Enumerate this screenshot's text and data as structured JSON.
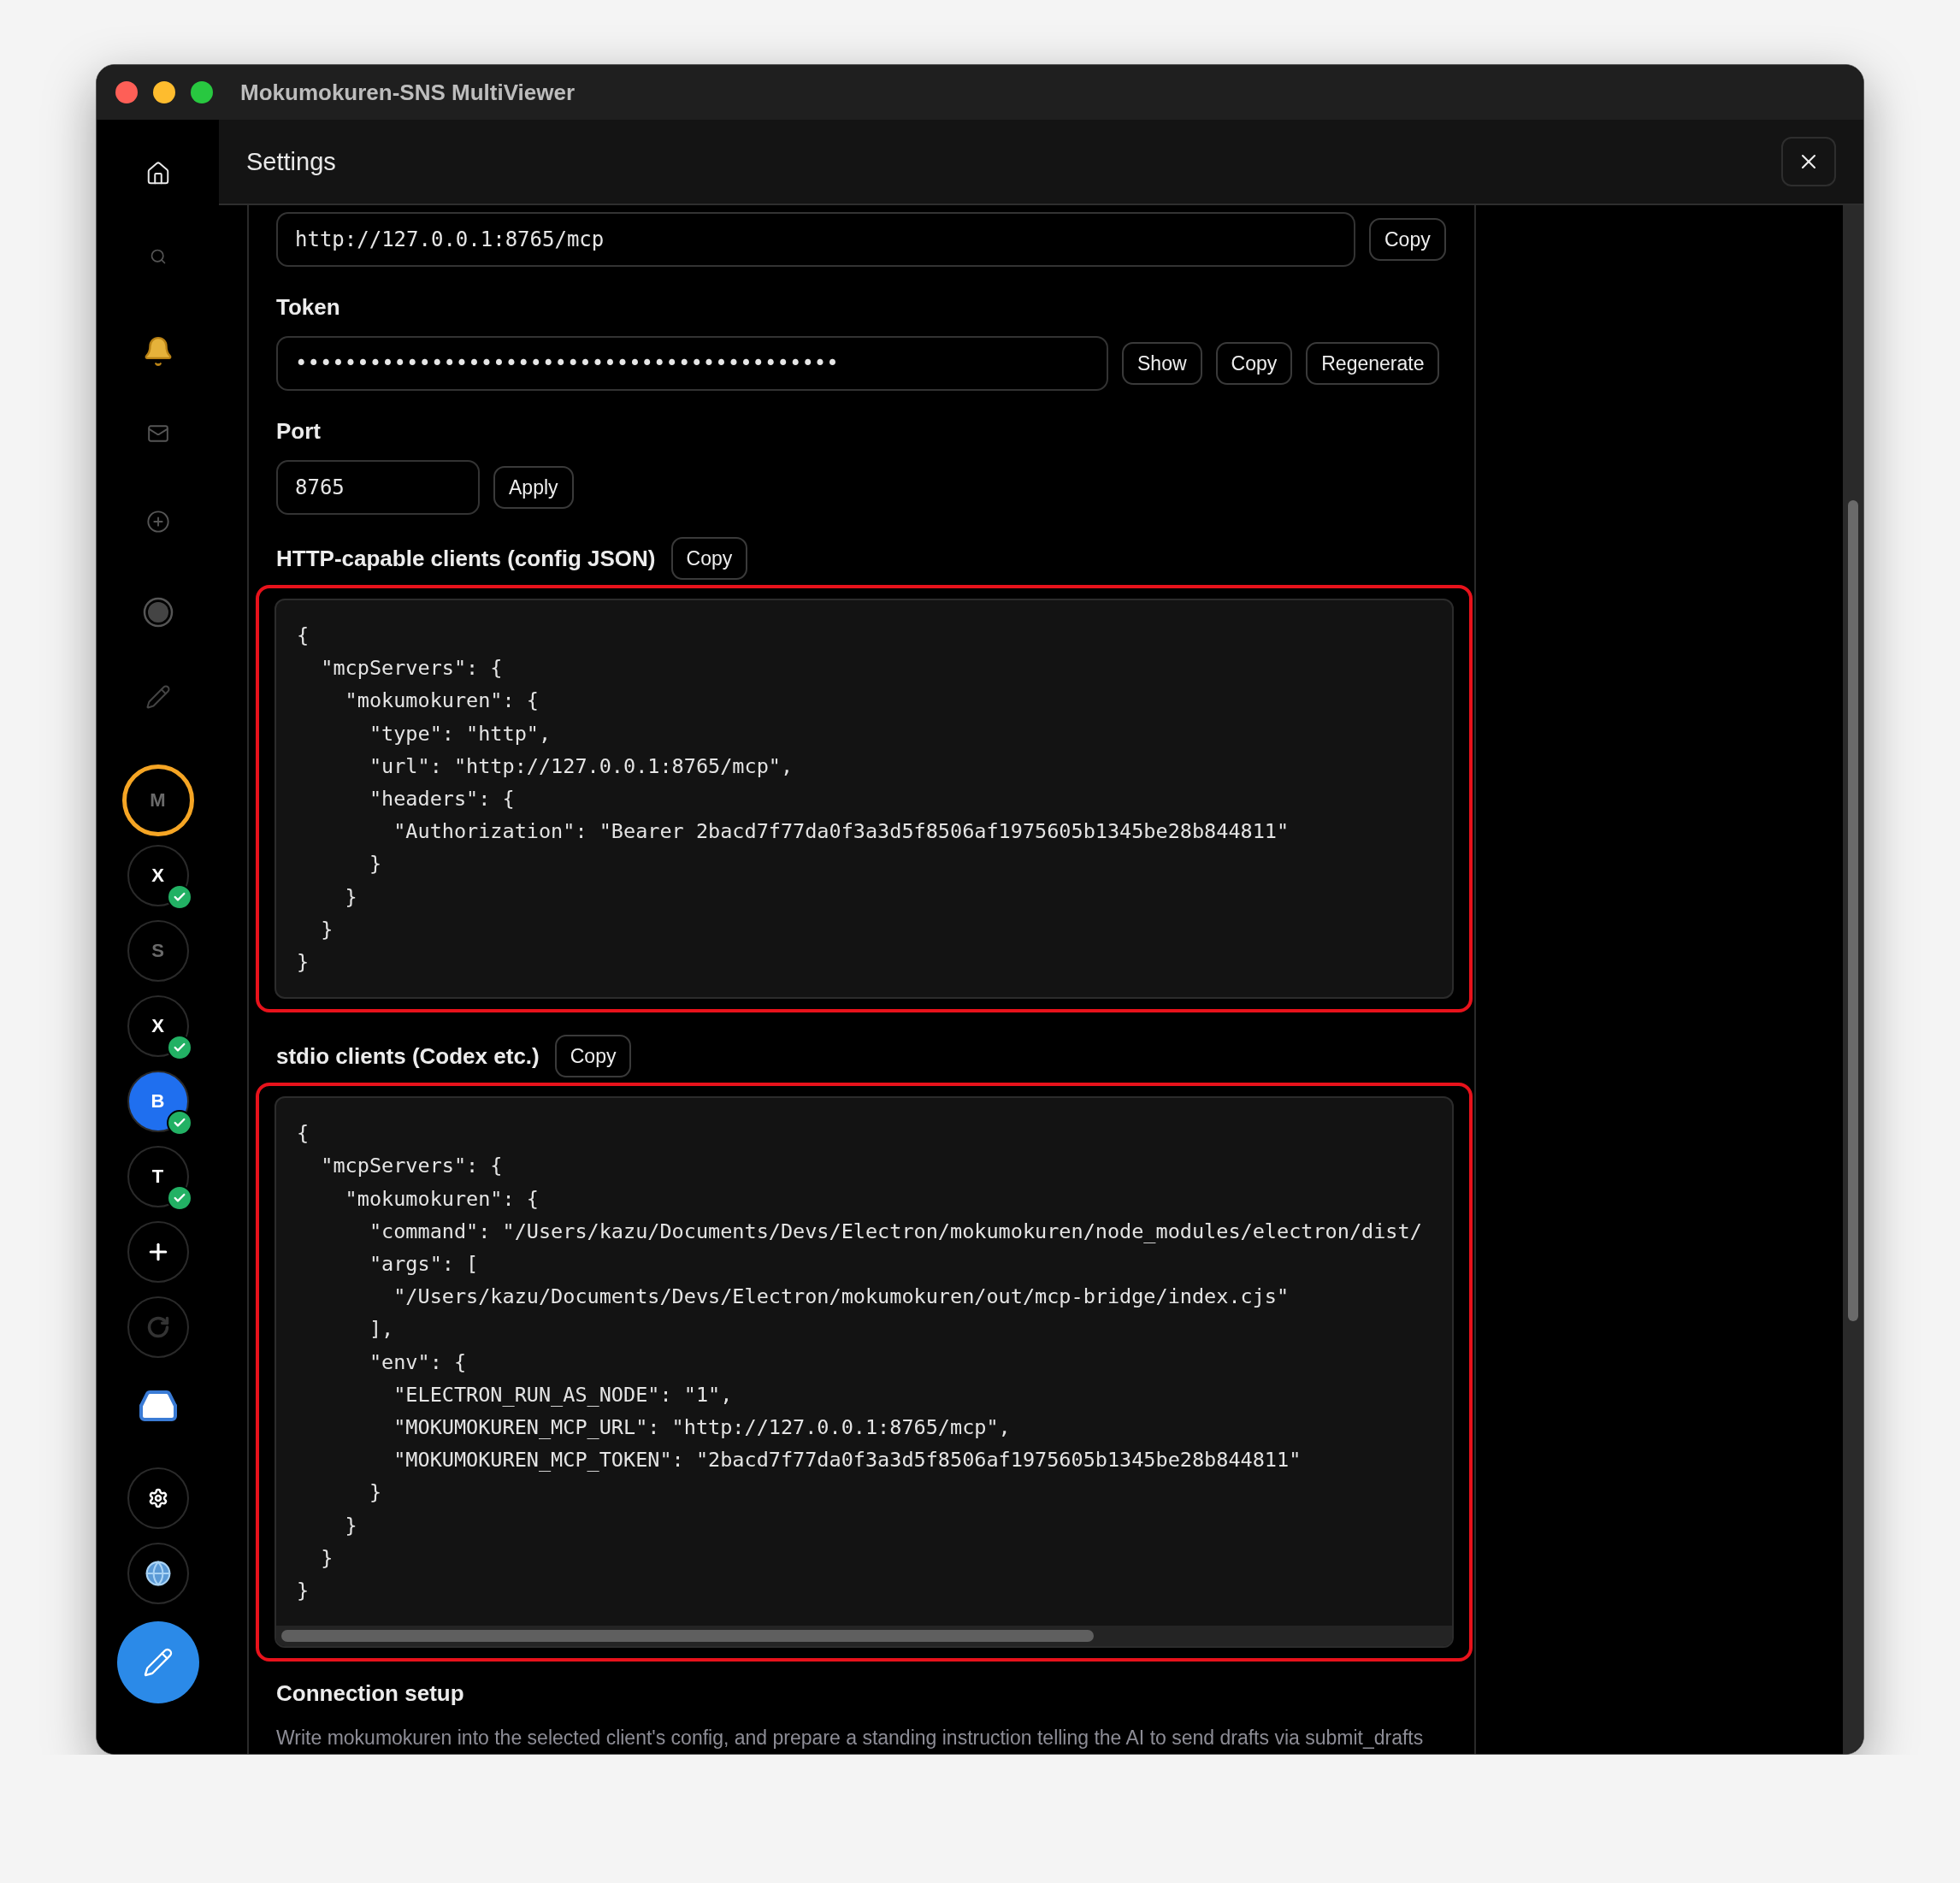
{
  "window": {
    "title": "Mokumokuren-SNS MultiViewer"
  },
  "sidebar": {
    "accounts": [
      {
        "label": "M",
        "connected": false,
        "selected": true
      },
      {
        "label": "X",
        "connected": true,
        "selected": false
      },
      {
        "label": "S",
        "connected": false,
        "selected": false
      },
      {
        "label": "X",
        "connected": true,
        "selected": false
      },
      {
        "label": "B",
        "connected": true,
        "selected": false,
        "color": "#1f6fef"
      },
      {
        "label": "T",
        "connected": true,
        "selected": false
      }
    ]
  },
  "header": {
    "title": "Settings"
  },
  "endpoint": {
    "value": "http://127.0.0.1:8765/mcp",
    "buttons": [
      "Copy"
    ]
  },
  "token": {
    "label": "Token",
    "value": "••••••••••••••••••••••••••••••••••••••••••••",
    "buttons": [
      "Show",
      "Copy",
      "Regenerate"
    ]
  },
  "port": {
    "label": "Port",
    "value": "8765",
    "buttons": [
      "Apply"
    ]
  },
  "http_config": {
    "label": "HTTP-capable clients (config JSON)",
    "button": "Copy",
    "code": "{\n  \"mcpServers\": {\n    \"mokumokuren\": {\n      \"type\": \"http\",\n      \"url\": \"http://127.0.0.1:8765/mcp\",\n      \"headers\": {\n        \"Authorization\": \"Bearer 2bacd7f77da0f3a3d5f8506af1975605b1345be28b844811\"\n      }\n    }\n  }\n}"
  },
  "stdio_config": {
    "label": "stdio clients (Codex etc.)",
    "button": "Copy",
    "code": "{\n  \"mcpServers\": {\n    \"mokumokuren\": {\n      \"command\": \"/Users/kazu/Documents/Devs/Electron/mokumokuren/node_modules/electron/dist/\n      \"args\": [\n        \"/Users/kazu/Documents/Devs/Electron/mokumokuren/out/mcp-bridge/index.cjs\"\n      ],\n      \"env\": {\n        \"ELECTRON_RUN_AS_NODE\": \"1\",\n        \"MOKUMOKUREN_MCP_URL\": \"http://127.0.0.1:8765/mcp\",\n        \"MOKUMOKUREN_MCP_TOKEN\": \"2bacd7f77da0f3a3d5f8506af1975605b1345be28b844811\"\n      }\n    }\n  }\n}"
  },
  "connection_setup": {
    "title": "Connection setup",
    "description": "Write mokumokuren into the selected client's config, and prepare a standing instruction telling the AI to send drafts via submit_drafts"
  }
}
